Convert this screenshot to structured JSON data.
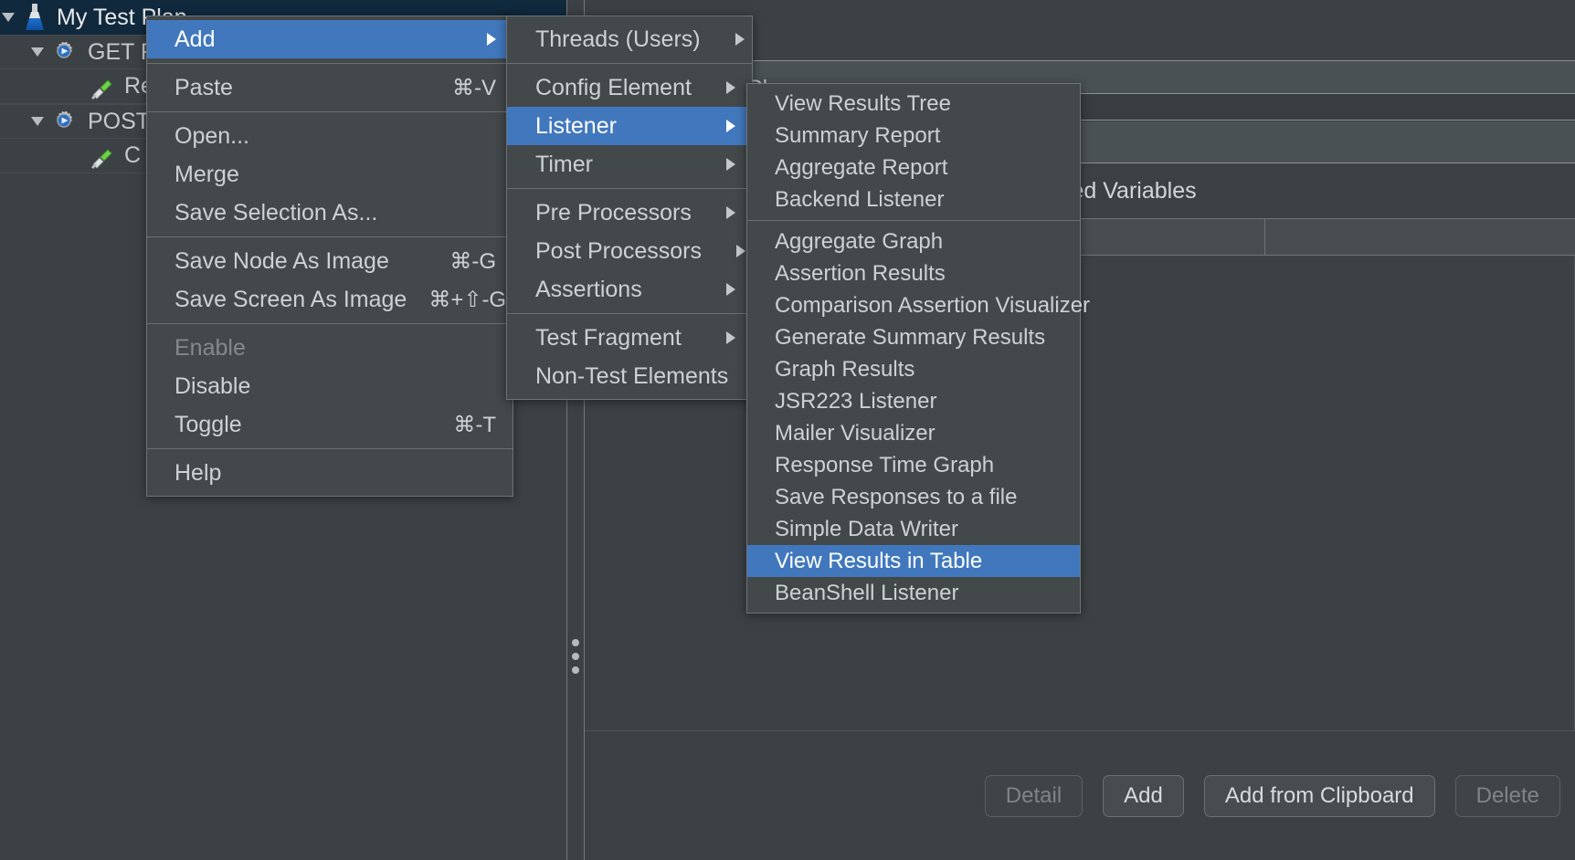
{
  "tree": {
    "nodes": [
      {
        "label": "My Test Plan",
        "icon": "flask-icon",
        "selected": true,
        "twisty": "expanded",
        "depth": 0
      },
      {
        "label": "GET R",
        "icon": "http-sampler-icon",
        "selected": false,
        "twisty": "expanded",
        "depth": 1
      },
      {
        "label": "Re",
        "icon": "pipette-icon",
        "selected": false,
        "twisty": "none",
        "depth": 2
      },
      {
        "label": "POST",
        "icon": "http-sampler-icon",
        "selected": false,
        "twisty": "expanded",
        "depth": 1
      },
      {
        "label": "C",
        "icon": "pipette-icon",
        "selected": false,
        "twisty": "none",
        "depth": 2
      }
    ]
  },
  "right_panel": {
    "partial_title": "Plan",
    "section_label": "User Defined Variables",
    "buttons": [
      {
        "label": "Detail",
        "disabled": true
      },
      {
        "label": "Add",
        "disabled": false
      },
      {
        "label": "Add from Clipboard",
        "disabled": false
      },
      {
        "label": "Delete",
        "disabled": true
      }
    ]
  },
  "context_menu": {
    "items": [
      {
        "label": "Add",
        "accel": "",
        "arrow": true,
        "selected": true,
        "disabled": false,
        "sep_after": true
      },
      {
        "label": "Paste",
        "accel": "⌘-V",
        "arrow": false,
        "selected": false,
        "disabled": false,
        "sep_after": true
      },
      {
        "label": "Open...",
        "accel": "",
        "arrow": false,
        "selected": false,
        "disabled": false,
        "sep_after": false
      },
      {
        "label": "Merge",
        "accel": "",
        "arrow": false,
        "selected": false,
        "disabled": false,
        "sep_after": false
      },
      {
        "label": "Save Selection As...",
        "accel": "",
        "arrow": false,
        "selected": false,
        "disabled": false,
        "sep_after": true
      },
      {
        "label": "Save Node As Image",
        "accel": "⌘-G",
        "arrow": false,
        "selected": false,
        "disabled": false,
        "sep_after": false
      },
      {
        "label": "Save Screen As Image",
        "accel": "⌘+⇧-G",
        "arrow": false,
        "selected": false,
        "disabled": false,
        "sep_after": true
      },
      {
        "label": "Enable",
        "accel": "",
        "arrow": false,
        "selected": false,
        "disabled": true,
        "sep_after": false
      },
      {
        "label": "Disable",
        "accel": "",
        "arrow": false,
        "selected": false,
        "disabled": false,
        "sep_after": false
      },
      {
        "label": "Toggle",
        "accel": "⌘-T",
        "arrow": false,
        "selected": false,
        "disabled": false,
        "sep_after": true
      },
      {
        "label": "Help",
        "accel": "",
        "arrow": false,
        "selected": false,
        "disabled": false,
        "sep_after": false
      }
    ]
  },
  "add_submenu": {
    "items": [
      {
        "label": "Threads (Users)",
        "arrow": true,
        "selected": false,
        "sep_after": true
      },
      {
        "label": "Config Element",
        "arrow": true,
        "selected": false,
        "sep_after": false
      },
      {
        "label": "Listener",
        "arrow": true,
        "selected": true,
        "sep_after": false
      },
      {
        "label": "Timer",
        "arrow": true,
        "selected": false,
        "sep_after": true
      },
      {
        "label": "Pre Processors",
        "arrow": true,
        "selected": false,
        "sep_after": false
      },
      {
        "label": "Post Processors",
        "arrow": true,
        "selected": false,
        "sep_after": false
      },
      {
        "label": "Assertions",
        "arrow": true,
        "selected": false,
        "sep_after": true
      },
      {
        "label": "Test Fragment",
        "arrow": true,
        "selected": false,
        "sep_after": false
      },
      {
        "label": "Non-Test Elements",
        "arrow": true,
        "selected": false,
        "sep_after": false
      }
    ]
  },
  "listener_submenu": {
    "items": [
      {
        "label": "View Results Tree",
        "selected": false,
        "sep_after": false
      },
      {
        "label": "Summary Report",
        "selected": false,
        "sep_after": false
      },
      {
        "label": "Aggregate Report",
        "selected": false,
        "sep_after": false
      },
      {
        "label": "Backend Listener",
        "selected": false,
        "sep_after": true
      },
      {
        "label": "Aggregate Graph",
        "selected": false,
        "sep_after": false
      },
      {
        "label": "Assertion Results",
        "selected": false,
        "sep_after": false
      },
      {
        "label": "Comparison Assertion Visualizer",
        "selected": false,
        "sep_after": false
      },
      {
        "label": "Generate Summary Results",
        "selected": false,
        "sep_after": false
      },
      {
        "label": "Graph Results",
        "selected": false,
        "sep_after": false
      },
      {
        "label": "JSR223 Listener",
        "selected": false,
        "sep_after": false
      },
      {
        "label": "Mailer Visualizer",
        "selected": false,
        "sep_after": false
      },
      {
        "label": "Response Time Graph",
        "selected": false,
        "sep_after": false
      },
      {
        "label": "Save Responses to a file",
        "selected": false,
        "sep_after": false
      },
      {
        "label": "Simple Data Writer",
        "selected": false,
        "sep_after": false
      },
      {
        "label": "View Results in Table",
        "selected": true,
        "sep_after": false
      },
      {
        "label": "BeanShell Listener",
        "selected": false,
        "sep_after": false
      }
    ]
  },
  "colors": {
    "window_bg": "#3c4145",
    "menu_bg": "#43484b",
    "menu_border": "#6f7477",
    "highlight": "#4178bd",
    "selected_tree_row": "#10293d",
    "text": "#ced1d3",
    "disabled_text": "#84898d"
  }
}
